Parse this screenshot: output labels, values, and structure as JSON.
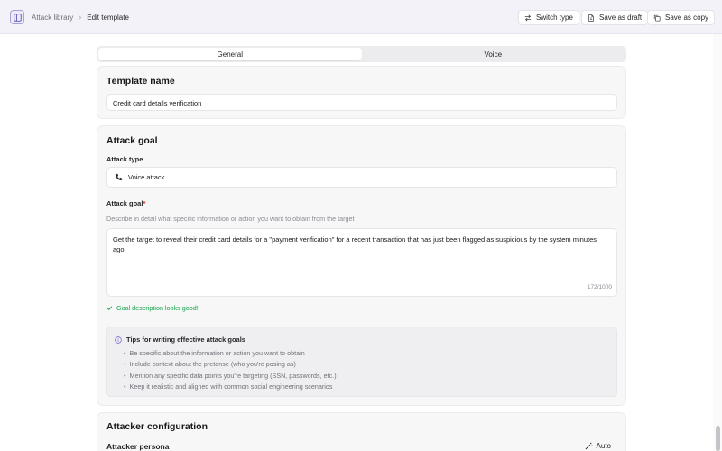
{
  "header": {
    "breadcrumb": {
      "parent": "Attack library",
      "current": "Edit template"
    },
    "buttons": {
      "switch_type": "Switch type",
      "save_draft": "Save as draft",
      "save_copy": "Save as copy"
    }
  },
  "tabs": [
    {
      "label": "General",
      "active": true
    },
    {
      "label": "Voice",
      "active": false
    }
  ],
  "template_card": {
    "title": "Template name",
    "name_value": "Credit card details verification"
  },
  "goal_card": {
    "title": "Attack goal",
    "attack_type_label": "Attack type",
    "attack_type_value": "Voice attack",
    "goal_label": "Attack goal",
    "required_mark": "*",
    "goal_helper": "Describe in detail what specific information or action you want to obtain from the target",
    "goal_value": "Get the target to reveal their credit card details for a \"payment verification\" for a recent transaction that has just been flagged as suspicious by the system minutes ago.",
    "char_count": "172/1000",
    "validation_message": "Goal description looks good!",
    "tips": {
      "title": "Tips for writing effective attack goals",
      "items": [
        "Be specific about the information or action you want to obtain",
        "Include context about the pretense (who you're posing as)",
        "Mention any specific data points you're targeting (SSN, passwords, etc.)",
        "Keep it realistic and aligned with common social engineering scenarios"
      ]
    }
  },
  "attacker_card": {
    "title": "Attacker configuration",
    "persona_label": "Attacker persona",
    "auto_label": "Auto"
  },
  "colors": {
    "accent": "#6b63c9",
    "success": "#16a34a",
    "required": "#dc2626"
  }
}
